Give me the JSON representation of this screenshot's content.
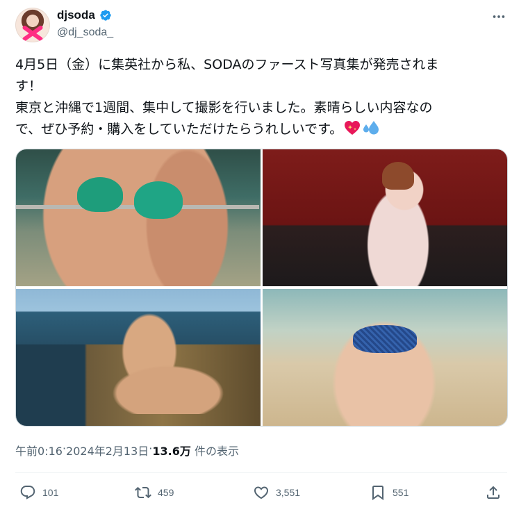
{
  "author": {
    "display_name": "djsoda",
    "handle": "@dj_soda_",
    "verified_color": "#1d9bf0"
  },
  "tweet": {
    "line1": "4月5日（金）に集英社から私、SODAのファースト写真集が発売されま",
    "line2": "す！",
    "line3": "東京と沖縄で1週間、集中して撮影を行いました。素晴らしい内容なの",
    "line4": "で、ぜひ予約・購入をしていただけたらうれしいです。",
    "emojis": [
      "sparkling-heart",
      "sweat-droplets"
    ]
  },
  "media": {
    "count": 4
  },
  "meta": {
    "time": "午前0:16",
    "date": "2024年2月13日",
    "views": "13.6万",
    "views_label": "件の表示",
    "separator": " · "
  },
  "actions": {
    "replies": "101",
    "reposts": "459",
    "likes": "3,551",
    "bookmarks": "551"
  },
  "colors": {
    "text": "#0f1419",
    "secondary": "#536471",
    "border": "#cfd9de"
  }
}
